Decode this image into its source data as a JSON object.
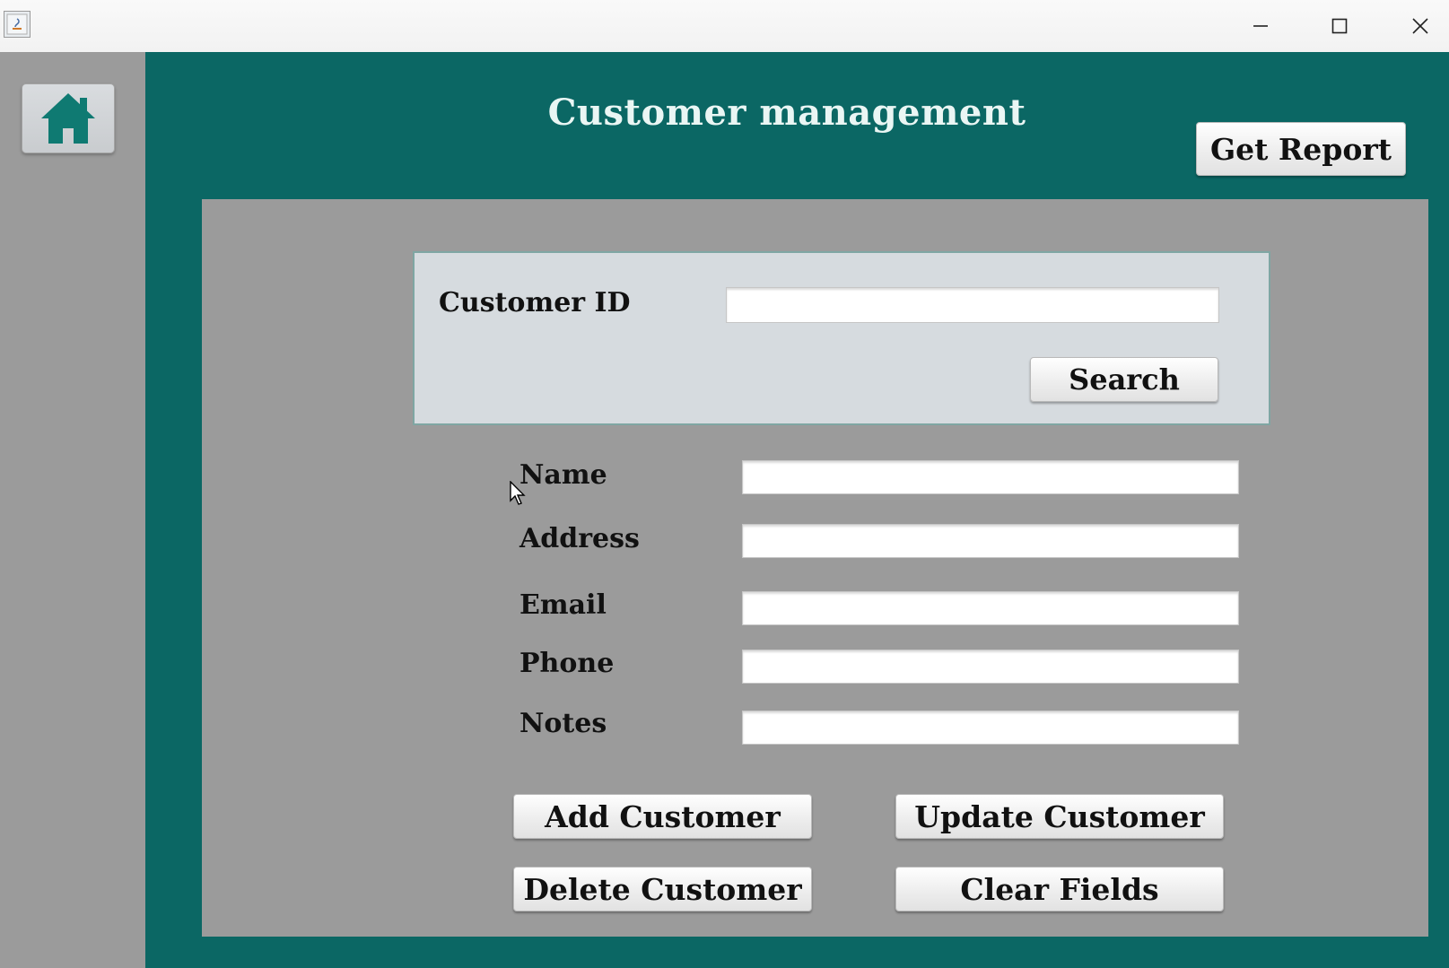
{
  "window": {
    "controls": {
      "minimize_icon": "minimize-icon",
      "maximize_icon": "maximize-icon",
      "close_icon": "close-icon"
    }
  },
  "sidebar": {
    "home_icon": "home-icon"
  },
  "header": {
    "title": "Customer management",
    "get_report_label": "Get Report"
  },
  "search": {
    "customer_id_label": "Customer ID",
    "customer_id_value": "",
    "search_label": "Search"
  },
  "form": {
    "fields": [
      {
        "label": "Name",
        "value": ""
      },
      {
        "label": "Address",
        "value": ""
      },
      {
        "label": "Email",
        "value": ""
      },
      {
        "label": "Phone",
        "value": ""
      },
      {
        "label": "Notes",
        "value": ""
      }
    ]
  },
  "actions": {
    "add_label": "Add Customer",
    "update_label": "Update Customer",
    "delete_label": "Delete Customer",
    "clear_label": "Clear Fields"
  },
  "colors": {
    "teal": "#0b6764",
    "panel_gray": "#9b9b9b",
    "search_box": "#d6dbdf",
    "title_text": "#eaf6f4"
  }
}
